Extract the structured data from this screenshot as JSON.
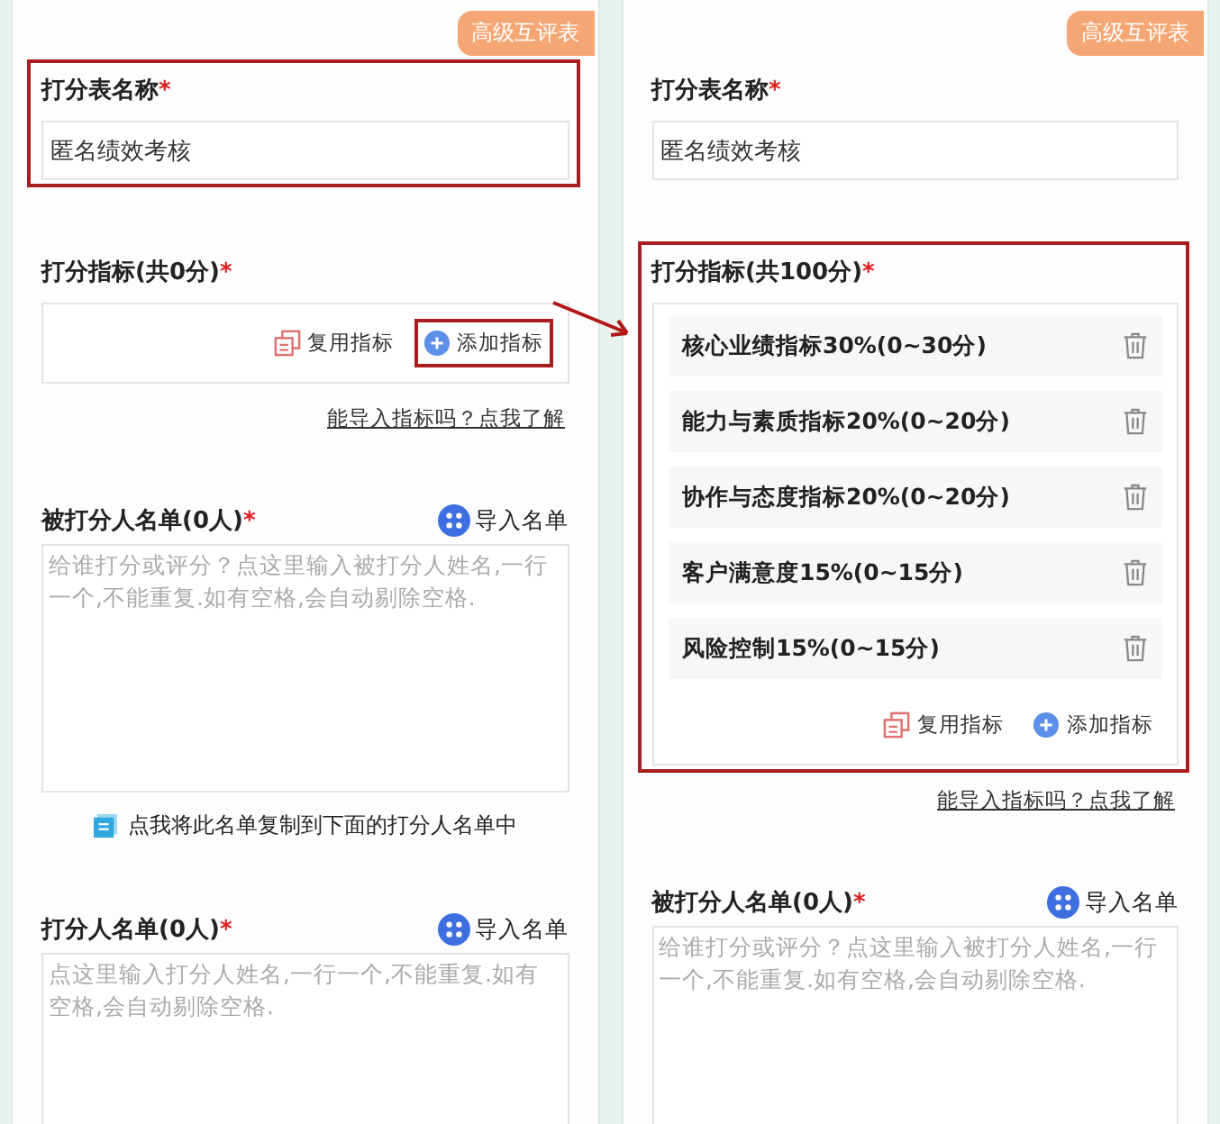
{
  "panels": [
    {
      "badge": "高级互评表",
      "sections": [
        {
          "kind": "name",
          "label": "打分表名称",
          "required": "*",
          "value": "匿名绩效考核",
          "highlighted": true
        },
        {
          "kind": "indicators",
          "label": "打分指标(共0分)",
          "required": "*",
          "reuse": "复用指标",
          "add": "添加指标",
          "add_highlighted": true,
          "help_link": "能导入指标吗？点我了解",
          "highlighted": false
        },
        {
          "kind": "list",
          "label": "被打分人名单(0人)",
          "required": "*",
          "import": "导入名单",
          "placeholder": "给谁打分或评分？点这里输入被打分人姓名,一行一个,不能重复.如有空格,会自动剔除空格.",
          "copy_link": "点我将此名单复制到下面的打分人名单中"
        },
        {
          "kind": "list",
          "label": "打分人名单(0人)",
          "required": "*",
          "import": "导入名单",
          "placeholder": "点这里输入打分人姓名,一行一个,不能重复.如有空格,会自动剔除空格."
        }
      ]
    },
    {
      "badge": "高级互评表",
      "sections": [
        {
          "kind": "name",
          "label": "打分表名称",
          "required": "*",
          "value": "匿名绩效考核",
          "highlighted": false
        },
        {
          "kind": "indicators",
          "label": "打分指标(共100分)",
          "required": "*",
          "items": [
            "核心业绩指标30%(0~30分)",
            "能力与素质指标20%(0~20分)",
            "协作与态度指标20%(0~20分)",
            "客户满意度15%(0~15分)",
            "风险控制15%(0~15分)"
          ],
          "reuse": "复用指标",
          "add": "添加指标",
          "add_highlighted": false,
          "help_link": "能导入指标吗？点我了解",
          "highlighted": true
        },
        {
          "kind": "list",
          "label": "被打分人名单(0人)",
          "required": "*",
          "import": "导入名单",
          "placeholder": "给谁打分或评分？点这里输入被打分人姓名,一行一个,不能重复.如有空格,会自动剔除空格."
        }
      ]
    }
  ]
}
